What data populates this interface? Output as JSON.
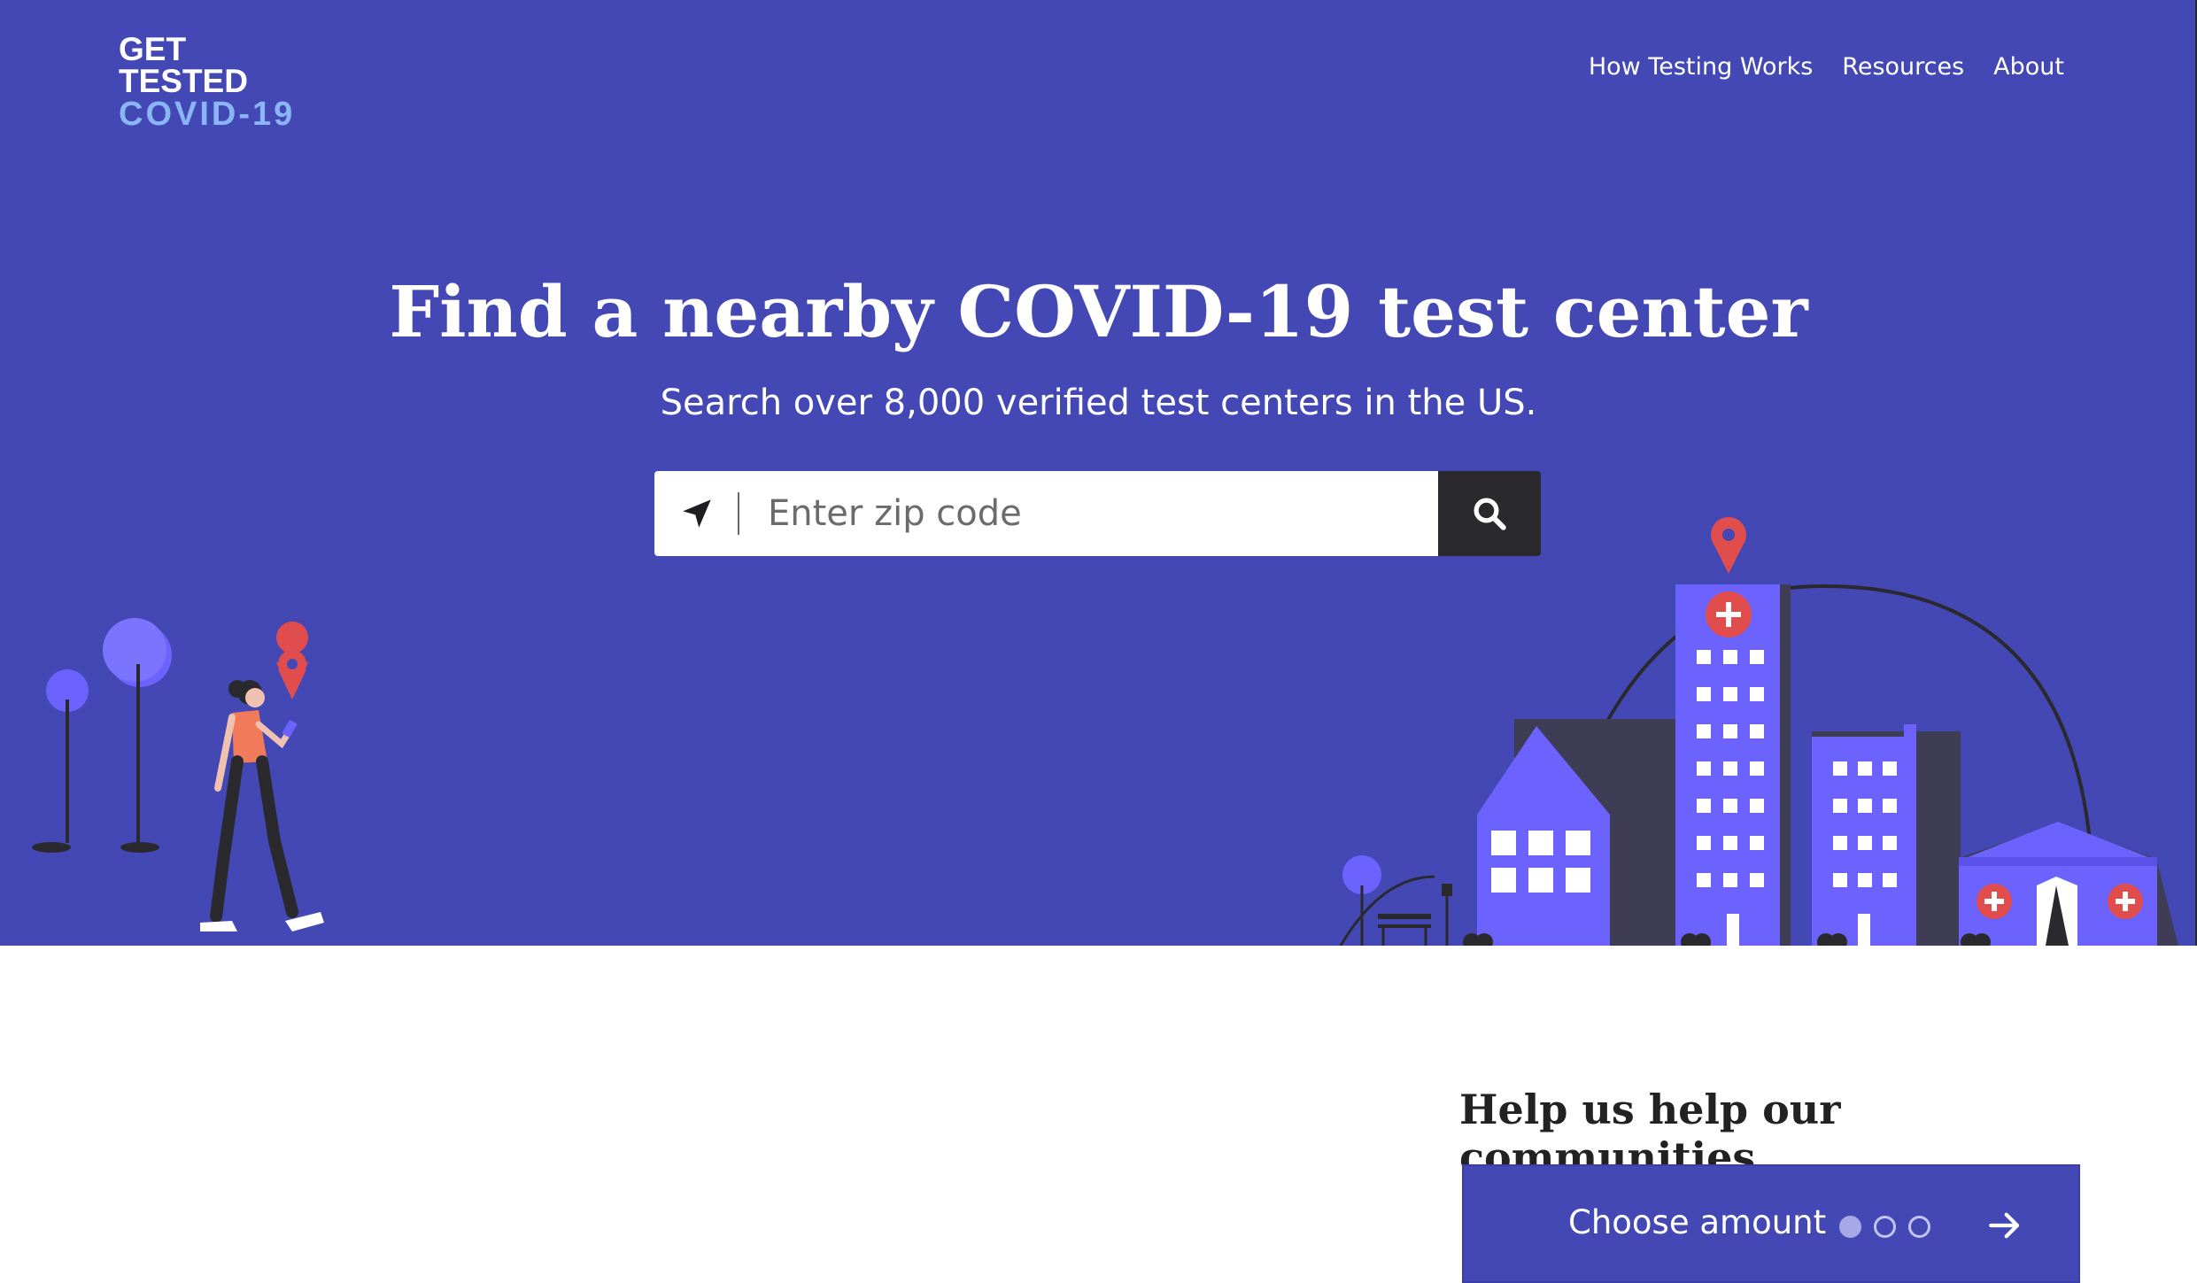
{
  "brand": {
    "line1": "GET TESTED",
    "line2": "COVID-19"
  },
  "nav": {
    "items": [
      "How Testing Works",
      "Resources",
      "About"
    ]
  },
  "hero": {
    "title": "Find a nearby COVID-19 test center",
    "subtitle": "Search over 8,000 verified test centers in the US."
  },
  "search": {
    "placeholder": "Enter zip code",
    "value": "",
    "locate_icon": "location-arrow-icon",
    "submit_icon": "search-icon"
  },
  "donate": {
    "heading": "Help us help our communities",
    "button_label": "Choose amount",
    "step_current": 1,
    "step_total": 3,
    "next_icon": "arrow-right-icon"
  },
  "colors": {
    "hero_bg": "#4448b4",
    "accent_light": "#8ab6f5",
    "building": "#6c63ff",
    "pin": "#e14d4d",
    "dark": "#2a2a2e"
  }
}
